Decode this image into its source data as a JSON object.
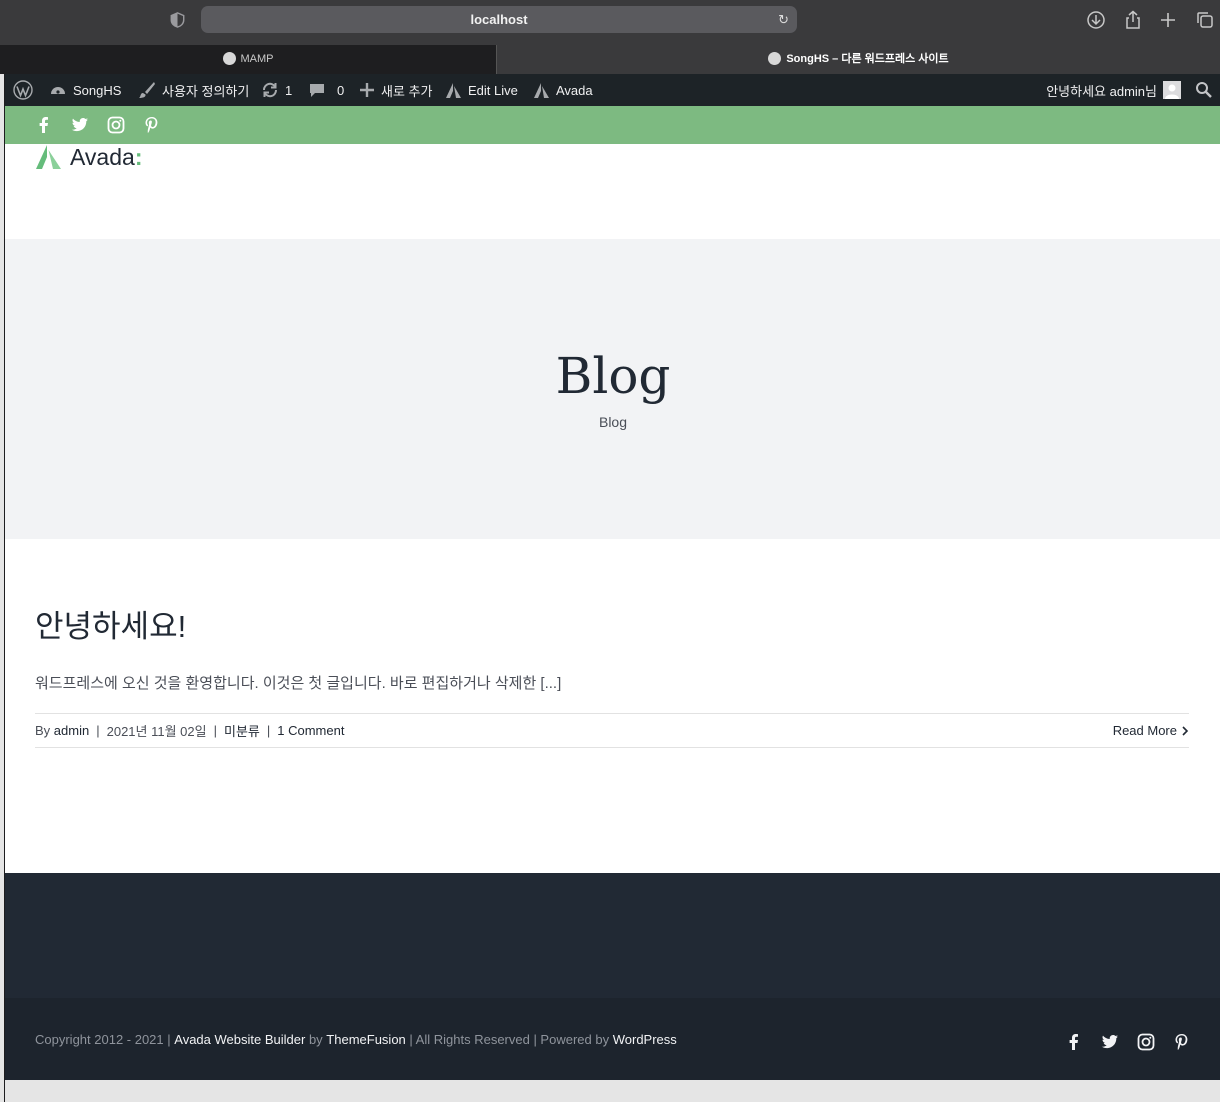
{
  "browser": {
    "url": "localhost",
    "tabs": [
      {
        "label": "MAMP"
      },
      {
        "label": "SongHS – 다른 워드프레스 사이트"
      }
    ]
  },
  "admin_bar": {
    "site_name": "SongHS",
    "customize": "사용자 정의하기",
    "updates_count": "1",
    "comments_count": "0",
    "new": "새로 추가",
    "edit_live": "Edit Live",
    "avada": "Avada",
    "greeting": "안녕하세요 admin님"
  },
  "header": {
    "logo_text": "Avada",
    "logo_colon": ":"
  },
  "page_title": {
    "title": "Blog",
    "breadcrumb": "Blog"
  },
  "post": {
    "title": "안녕하세요!",
    "excerpt": "워드프레스에 오신 것을 환영합니다. 이것은 첫 글입니다. 바로 편집하거나 삭제한 [...]",
    "meta": {
      "by": "By",
      "author": "admin",
      "date": "2021년 11월 02일",
      "category": "미분류",
      "comments": "1 Comment",
      "sep": "|"
    },
    "read_more": "Read More"
  },
  "footer": {
    "copyright_prefix": "Copyright 2012 - 2021 |",
    "builder_link": "Avada Website Builder",
    "by": "by",
    "themefusion": "ThemeFusion",
    "rights": "| All Rights Reserved | Powered by",
    "wordpress": "WordPress"
  },
  "icons": {
    "social": [
      "facebook-icon",
      "twitter-icon",
      "instagram-icon",
      "pinterest-icon"
    ]
  },
  "colors": {
    "accent_green": "#7dba81",
    "admin_bar": "#1d2327",
    "footer": "#212934",
    "title_bar": "#f2f3f5"
  }
}
